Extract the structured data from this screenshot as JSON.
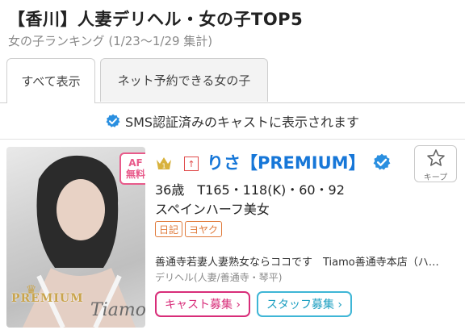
{
  "header": {
    "title": "【香川】人妻デリヘル・女の子TOP5",
    "subtitle": "女の子ランキング (1/23～1/29 集計)"
  },
  "tabs": [
    {
      "label": "すべて表示",
      "active": true
    },
    {
      "label": "ネット予約できる女の子",
      "active": false
    }
  ],
  "sms_notice": "SMS認証済みのキャストに表示されます",
  "card": {
    "af_badge": "AF\n無料",
    "af_line1": "AF",
    "af_line2": "無料",
    "photo_premium": "PREMIUM",
    "photo_shop": "Tiamo",
    "rank": "1",
    "rank_icon": "crown-icon",
    "name": "りさ【PREMIUM】",
    "favorite_label": "キープ",
    "stats": "36歳　T165・118(K)・60・92",
    "catchphrase": "スペインハーフ美女",
    "tags": [
      "日記",
      "ヨヤク"
    ],
    "description": "善通寺若妻人妻熟女ならココです　Tiamo善通寺本店（ハ…",
    "genre": "デリヘル(人妻/善通寺・琴平)",
    "buttons": {
      "cast": "キャスト募集 ›",
      "staff": "スタッフ募集 ›"
    }
  },
  "colors": {
    "name_blue": "#1777d8",
    "cast_pink": "#d82d79",
    "staff_cyan": "#3fb6d6",
    "tag_orange": "#e07a3a",
    "verified_blue": "#2a8fe0"
  }
}
